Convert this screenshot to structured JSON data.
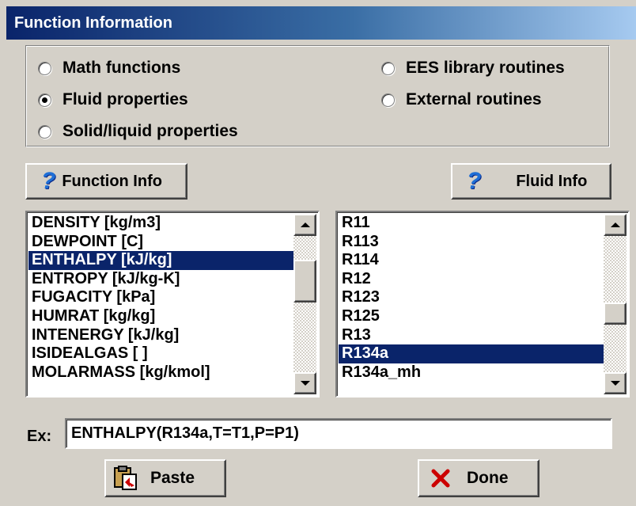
{
  "window": {
    "title": "Function Information"
  },
  "function_type": {
    "options": [
      {
        "label": "Math functions",
        "checked": false
      },
      {
        "label": "Fluid properties",
        "checked": true
      },
      {
        "label": "Solid/liquid properties",
        "checked": false
      },
      {
        "label": "EES library routines",
        "checked": false
      },
      {
        "label": "External routines",
        "checked": false
      }
    ]
  },
  "buttons": {
    "function_info": "Function Info",
    "fluid_info": "Fluid Info",
    "paste": "Paste",
    "done": "Done"
  },
  "functions_list": {
    "items": [
      "DENSITY [kg/m3]",
      "DEWPOINT [C]",
      "ENTHALPY [kJ/kg]",
      "ENTROPY [kJ/kg-K]",
      "FUGACITY [kPa]",
      "HUMRAT [kg/kg]",
      "INTENERGY [kJ/kg]",
      "ISIDEALGAS [ ]",
      "MOLARMASS [kg/kmol]"
    ],
    "selected": "ENTHALPY [kJ/kg]"
  },
  "fluids_list": {
    "items": [
      "R11",
      "R113",
      "R114",
      "R12",
      "R123",
      "R125",
      "R13",
      "R134a",
      "R134a_mh"
    ],
    "selected": "R134a"
  },
  "example": {
    "label": "Ex:",
    "value": "ENTHALPY(R134a,T=T1,P=P1)"
  },
  "colors": {
    "selection": "#0a246a",
    "dialog_face": "#d4d0c8",
    "help_icon": "#1f6fd6",
    "done_icon": "#cc0000"
  }
}
